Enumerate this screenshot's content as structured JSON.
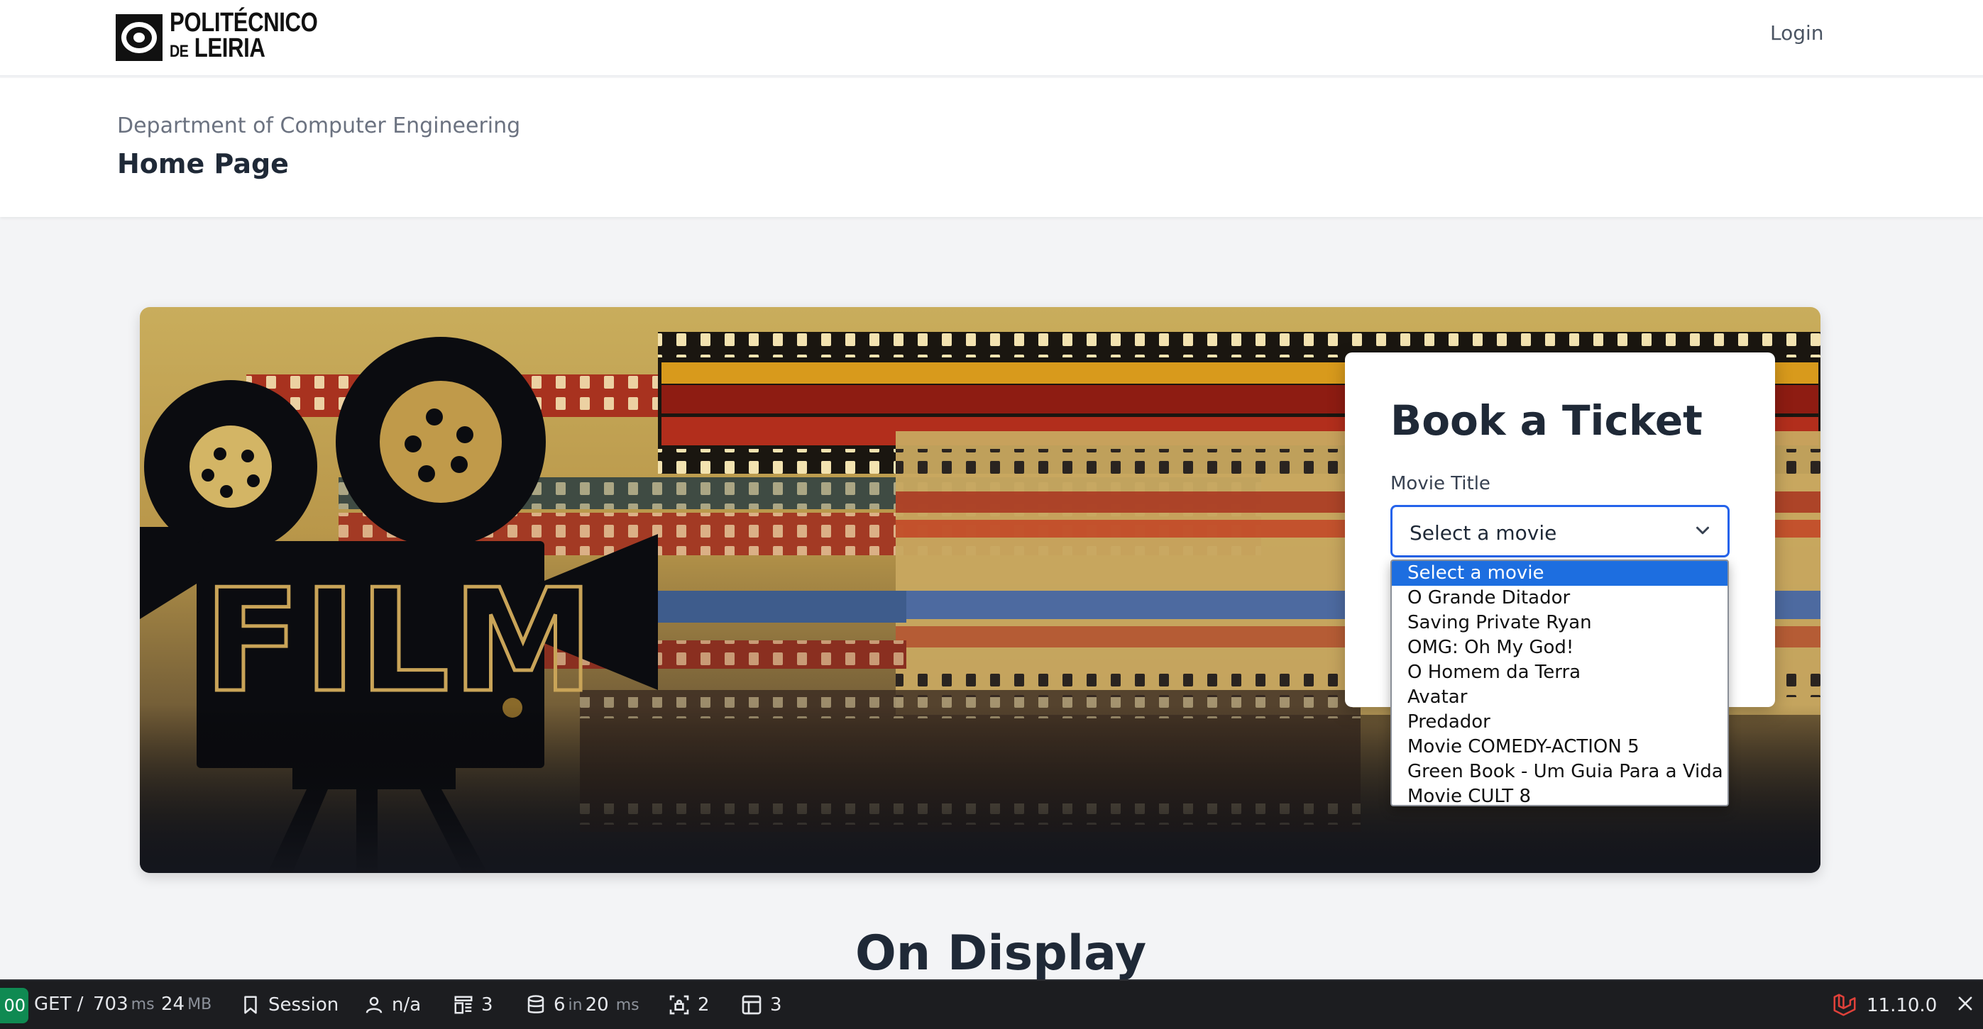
{
  "nav": {
    "logo_line1": "POLITÉCNICO",
    "logo_line2_prefix": "DE",
    "logo_line2": "LEIRIA",
    "login_label": "Login"
  },
  "header": {
    "department": "Department of Computer Engineering",
    "title": "Home Page"
  },
  "hero": {
    "film_word": "FILM"
  },
  "booking": {
    "title": "Book a Ticket",
    "movie_label": "Movie Title",
    "selected": "Select a movie",
    "options": [
      "Select a movie",
      "O Grande Ditador",
      "Saving Private Ryan",
      "OMG: Oh My God!",
      "O Homem da Terra",
      "Avatar",
      "Predador",
      "Movie COMEDY-ACTION 5",
      "Green Book - Um Guia Para a Vida",
      "Movie CULT 8"
    ]
  },
  "section": {
    "on_display": "On Display"
  },
  "debugbar": {
    "status": "00",
    "method": "GET /",
    "time_value": "703",
    "time_unit": "ms",
    "memory_value": "24",
    "memory_unit": "MB",
    "session_label": "Session",
    "user_label": "n/a",
    "views_count": "3",
    "queries_count": "6",
    "queries_in": "in",
    "queries_time": "20",
    "queries_unit": "ms",
    "gates_count": "2",
    "models_count": "3",
    "laravel_version": "11.10.0"
  },
  "colors": {
    "accent": "#2563eb",
    "selected_option": "#1d6ee0",
    "status_green": "#0f8a52",
    "laravel_red": "#e0413a"
  }
}
